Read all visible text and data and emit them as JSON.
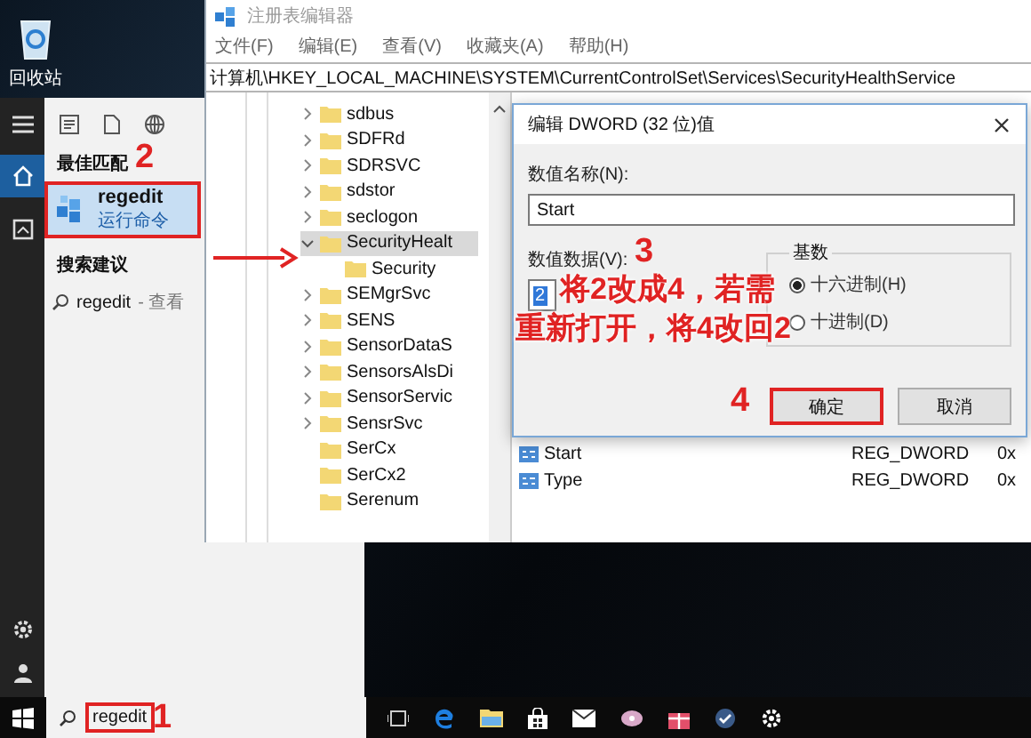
{
  "desktop": {
    "icons": [
      {
        "label": "回收站"
      }
    ]
  },
  "start_menu": {
    "best_match_heading": "最佳匹配",
    "best_match": {
      "title": "regedit",
      "subtitle": "运行命令",
      "selected": true,
      "annotated": true
    },
    "suggestions_heading": "搜索建议",
    "suggestions": [
      {
        "text": "regedit",
        "detail": "- 查看"
      }
    ]
  },
  "registry_editor": {
    "title": "注册表编辑器",
    "menu": [
      "文件(F)",
      "编辑(E)",
      "查看(V)",
      "收藏夹(A)",
      "帮助(H)"
    ],
    "address": "计算机\\HKEY_LOCAL_MACHINE\\SYSTEM\\CurrentControlSet\\Services\\SecurityHealthService",
    "tree": [
      {
        "label": "sdbus",
        "expandable": true,
        "expanded": false,
        "selected": false
      },
      {
        "label": "SDFRd",
        "expandable": true,
        "expanded": false,
        "selected": false
      },
      {
        "label": "SDRSVC",
        "expandable": true,
        "expanded": false,
        "selected": false
      },
      {
        "label": "sdstor",
        "expandable": true,
        "expanded": false,
        "selected": false
      },
      {
        "label": "seclogon",
        "expandable": true,
        "expanded": false,
        "selected": false
      },
      {
        "label": "SecurityHealt",
        "expandable": true,
        "expanded": true,
        "selected": true,
        "children": [
          {
            "label": "Security",
            "selected": false
          }
        ]
      },
      {
        "label": "SEMgrSvc",
        "expandable": true,
        "expanded": false,
        "selected": false
      },
      {
        "label": "SENS",
        "expandable": true,
        "expanded": false,
        "selected": false
      },
      {
        "label": "SensorDataS",
        "expandable": true,
        "expanded": false,
        "selected": false
      },
      {
        "label": "SensorsAlsDi",
        "expandable": true,
        "expanded": false,
        "selected": false
      },
      {
        "label": "SensorServic",
        "expandable": true,
        "expanded": false,
        "selected": false
      },
      {
        "label": "SensrSvc",
        "expandable": true,
        "expanded": false,
        "selected": false
      },
      {
        "label": "SerCx",
        "expandable": false,
        "expanded": false,
        "selected": false
      },
      {
        "label": "SerCx2",
        "expandable": false,
        "expanded": false,
        "selected": false
      },
      {
        "label": "Serenum",
        "expandable": false,
        "expanded": false,
        "selected": false
      }
    ],
    "values": [
      {
        "name": "Start",
        "type": "REG_DWORD",
        "data": "0x"
      },
      {
        "name": "Type",
        "type": "REG_DWORD",
        "data": "0x"
      }
    ]
  },
  "dialog": {
    "title": "编辑 DWORD (32 位)值",
    "name_label": "数值名称(N):",
    "name_value": "Start",
    "data_label": "数值数据(V):",
    "data_value": "2",
    "data_value_selected": true,
    "base_label": "基数",
    "bases": [
      {
        "label": "十六进制(H)",
        "selected": true
      },
      {
        "label": "十进制(D)",
        "selected": false
      }
    ],
    "buttons": [
      {
        "label": "确定",
        "default": true,
        "annotated": true
      },
      {
        "label": "取消",
        "default": false,
        "annotated": false
      }
    ]
  },
  "taskbar": {
    "search": {
      "value": "regedit",
      "annotated": true
    }
  },
  "annotations": {
    "steps": [
      "1",
      "2",
      "3",
      "4"
    ],
    "note_lines": [
      "将2改成4，若需",
      "重新打开，将4改回2"
    ]
  }
}
